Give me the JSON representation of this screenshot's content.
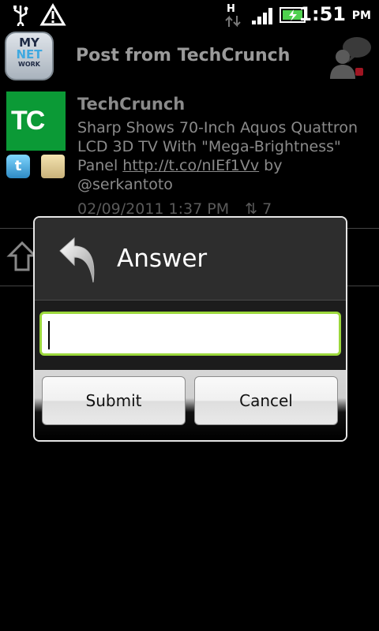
{
  "status_bar": {
    "time": "1:51",
    "ampm": "PM"
  },
  "header": {
    "title": "Post from TechCrunch",
    "logo_lines": [
      "MY",
      "NET",
      "WORK"
    ]
  },
  "post": {
    "avatar_text": "TC",
    "author": "TechCrunch",
    "text_before_link": "Sharp Shows 70-Inch Aquos Quattron LCD 3D TV With \"Mega-Brightness\" Panel ",
    "link": "http://t.co/nIEf1Vv",
    "text_after_link": " by @serkantoto",
    "timestamp": "02/09/2011 1:37 PM",
    "retweet_count": "7"
  },
  "dialog": {
    "title": "Answer",
    "input_value": "",
    "submit_label": "Submit",
    "cancel_label": "Cancel"
  },
  "colors": {
    "accent_green": "#9cd83c",
    "techcrunch_green": "#0b9a36"
  }
}
